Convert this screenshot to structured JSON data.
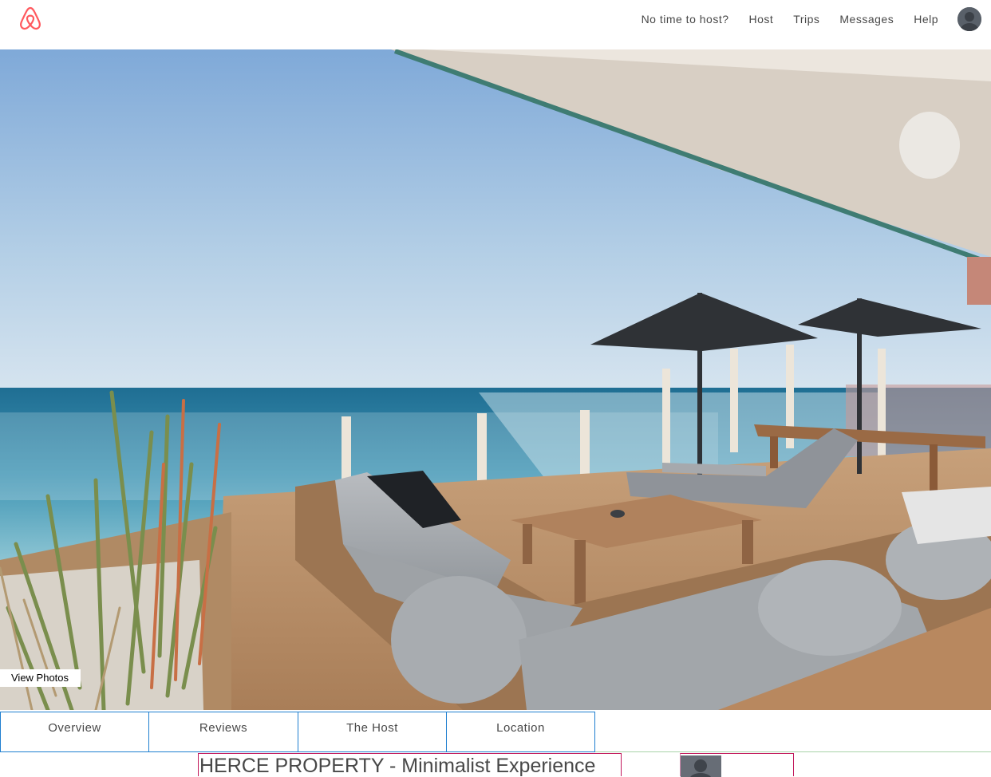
{
  "nav": {
    "items": [
      "No time to host?",
      "Host",
      "Trips",
      "Messages",
      "Help"
    ]
  },
  "hero": {
    "view_photos_label": "View Photos"
  },
  "tabs": [
    {
      "label": "Overview"
    },
    {
      "label": "Reviews"
    },
    {
      "label": "The Host"
    },
    {
      "label": "Location"
    }
  ],
  "listing": {
    "title": "HERCE PROPERTY - Minimalist Experience"
  },
  "colors": {
    "brand": "#ff5a5f",
    "tab_border": "#1f7fd0",
    "title_border": "#c2185b"
  },
  "icons": {
    "logo": "airbnb-belo-icon",
    "avatar": "user-avatar-icon"
  }
}
